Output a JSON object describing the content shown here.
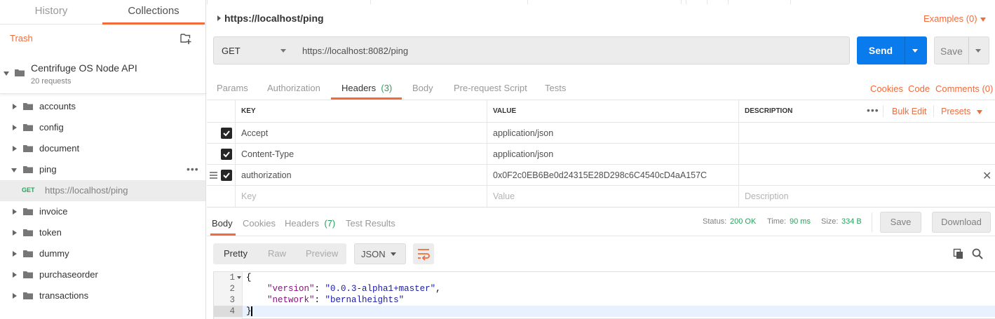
{
  "sidebar": {
    "tabs": [
      "History",
      "Collections"
    ],
    "trash_label": "Trash",
    "collection": {
      "name": "Centrifuge OS Node API",
      "count": "20 requests"
    },
    "folders": [
      "accounts",
      "config",
      "document",
      "ping",
      "invoice",
      "token",
      "dummy",
      "purchaseorder",
      "transactions"
    ],
    "ping_request": {
      "method": "GET",
      "url": "https://localhost/ping"
    }
  },
  "request": {
    "title": "https://localhost/ping",
    "examples_label": "Examples (0)",
    "method": "GET",
    "url": "https://localhost:8082/ping",
    "send_label": "Send",
    "save_label": "Save"
  },
  "request_tabs": {
    "params": "Params",
    "authorization": "Authorization",
    "headers": "Headers",
    "headers_count": "(3)",
    "body": "Body",
    "prerequest": "Pre-request Script",
    "tests": "Tests",
    "cookies": "Cookies",
    "code": "Code",
    "comments": "Comments (0)"
  },
  "headers_table": {
    "columns": {
      "key": "KEY",
      "value": "VALUE",
      "description": "DESCRIPTION"
    },
    "bulk_edit": "Bulk Edit",
    "presets": "Presets",
    "rows": [
      {
        "key": "Accept",
        "value": "application/json"
      },
      {
        "key": "Content-Type",
        "value": "application/json"
      },
      {
        "key": "authorization",
        "value": "0x0F2c0EB6Be0d24315E28D298c6C4540cD4aA157C"
      }
    ],
    "placeholders": {
      "key": "Key",
      "value": "Value",
      "description": "Description"
    }
  },
  "response": {
    "tabs": {
      "body": "Body",
      "cookies": "Cookies",
      "headers": "Headers",
      "headers_count": "(7)",
      "test_results": "Test Results"
    },
    "status_label": "Status:",
    "status": "200 OK",
    "time_label": "Time:",
    "time": "90 ms",
    "size_label": "Size:",
    "size": "334 B",
    "save_label": "Save",
    "download_label": "Download",
    "views": [
      "Pretty",
      "Raw",
      "Preview"
    ],
    "format": "JSON",
    "line_numbers": [
      "1",
      "2",
      "3",
      "4"
    ],
    "code": {
      "open": "{",
      "k1": "\"version\"",
      "v1": "\"0.0.3-alpha1+master\"",
      "k2": "\"network\"",
      "v2": "\"bernalheights\"",
      "close": "}"
    }
  },
  "colors": {
    "accent": "#f26b3a",
    "send": "#097bed",
    "success": "#2aa15c"
  }
}
